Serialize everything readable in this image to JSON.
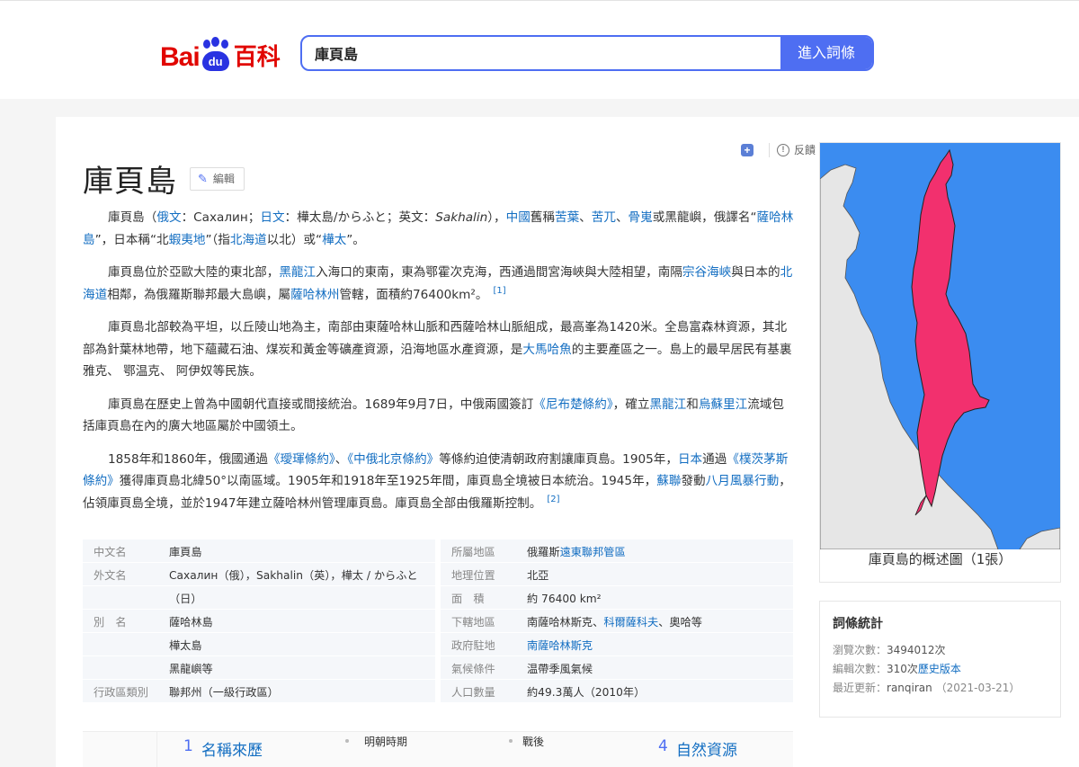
{
  "header": {
    "logo_bai": "Bai",
    "logo_du": "du",
    "logo_ke": "百科",
    "search_value": "庫頁島",
    "search_button": "進入詞條"
  },
  "tools": {
    "feedback": "反饋",
    "share": "分享"
  },
  "article": {
    "title": "庫頁島",
    "edit_label": "編輯",
    "p1": {
      "a": "庫頁島（",
      "l1": "俄文",
      "b": "：Сахалин；",
      "l2": "日文",
      "c": "：樺太島/からふと；英文：",
      "sakhalin": "Sakhalin",
      "d": "），",
      "l3": "中國",
      "e": "舊稱",
      "l4": "苦葉",
      "f": "、",
      "l5": "苦兀",
      "g": "、",
      "l6": "骨嵬",
      "h": "或黑龍嶼，俄譯名“",
      "l7": "薩哈林島",
      "i": "”，日本稱“北",
      "l8": "蝦夷地",
      "j": "”（指",
      "l9": "北海道",
      "k": "以北）或“",
      "l10": "樺太",
      "m": "”。"
    },
    "p2": {
      "a": "庫頁島位於亞歐大陸的東北部，",
      "l1": "黑龍江",
      "b": "入海口的東南，東為鄂霍次克海，西通過間宮海峽與大陸相望，南隔",
      "l2": "宗谷海峽",
      "c": "與日本的",
      "l3": "北海道",
      "d": "相鄰，為俄羅斯聯邦最大島嶼，屬",
      "l4": "薩哈林州",
      "e": "管轄，面積約76400km²。",
      "ref": "[1]"
    },
    "p3": {
      "a": "庫頁島北部較為平坦，以丘陵山地為主，南部由東薩哈林山脈和西薩哈林山脈組成，最高峯為1420米。全島富森林資源，其北部為針葉林地帶，地下蘊藏石油、煤炭和黃金等礦產資源，沿海地區水產資源，是",
      "l1": "大馬哈魚",
      "b": "的主要產區之一。島上的最早居民有基裏雅克、 鄂温克、 阿伊奴等民族。"
    },
    "p4": {
      "a": "庫頁島在歷史上曾為中國朝代直接或間接統治。1689年9月7日，中俄兩國簽訂",
      "l1": "《尼布楚條約》",
      "b": "，確立",
      "l2": "黑龍江",
      "c": "和",
      "l3": "烏蘇里江",
      "d": "流域包括庫頁島在內的廣大地區屬於中國領土。"
    },
    "p5": {
      "a": "1858年和1860年，俄國通過",
      "l1": "《璦琿條約》",
      "b": "、",
      "l2": "《中俄北京條約》",
      "c": "等條約迫使清朝政府割讓庫頁島。1905年，",
      "l3": "日本",
      "d": "通過",
      "l4": "《樸茨茅斯條約》",
      "e": "獲得庫頁島北緯50°以南區域。1905年和1918年至1925年間，庫頁島全境被日本統治。1945年，",
      "l5": "蘇聯",
      "f": "發動",
      "l6": "八月風暴行動",
      "g": "，佔領庫頁島全境，並於1947年建立薩哈林州管理庫頁島。庫頁島全部由俄羅斯控制。",
      "ref": "[2]"
    }
  },
  "basic_info": {
    "left": [
      {
        "k": "中文名",
        "v": "庫頁島"
      },
      {
        "k": "外文名",
        "v": "Сахалин（俄），Sakhalin（英），樺太 / からふと"
      },
      {
        "k": "",
        "v": "（日）"
      },
      {
        "k": "別　名",
        "v": "薩哈林島"
      },
      {
        "k": "",
        "v": "樺太島"
      },
      {
        "k": "",
        "v": "黑龍嶼等"
      },
      {
        "k": "行政區類別",
        "v": "聯邦州（一級行政區）"
      }
    ],
    "right": {
      "r1k": "所屬地區",
      "r1a": "俄羅斯",
      "r1b": "遠東聯邦管區",
      "r2k": "地理位置",
      "r2v": "北亞",
      "r3k": "面　積",
      "r3v": "約 76400 km²",
      "r4k": "下轄地區",
      "r4a": "南薩哈林斯克、",
      "r4b": "科爾薩科夫",
      "r4c": "、奧哈等",
      "r5k": "政府駐地",
      "r5v": "南薩哈林斯克",
      "r6k": "氣候條件",
      "r6v": "温帶季風氣候",
      "r7k": "人口數量",
      "r7v": "約49.3萬人（2010年）"
    }
  },
  "catalog": {
    "n1": "1",
    "l1": "名稱來歷",
    "s1": "明朝時期",
    "s2": "戰後",
    "n4": "4",
    "l4": "自然資源"
  },
  "side": {
    "map_caption": "庫頁島的概述圖（1張）",
    "colors": {
      "sea": "#3b8cf0",
      "land": "#e6e6e6",
      "island": "#f2306e"
    },
    "stats_title": "詞條統計",
    "views_label": "瀏覽次數：",
    "views_value": "3494012次",
    "edits_label": "編輯次數：",
    "edits_value": "310次",
    "history_link": "歷史版本",
    "updated_label": "最近更新：",
    "updated_user": "ranqiran",
    "updated_date": "（2021-03-21）"
  }
}
